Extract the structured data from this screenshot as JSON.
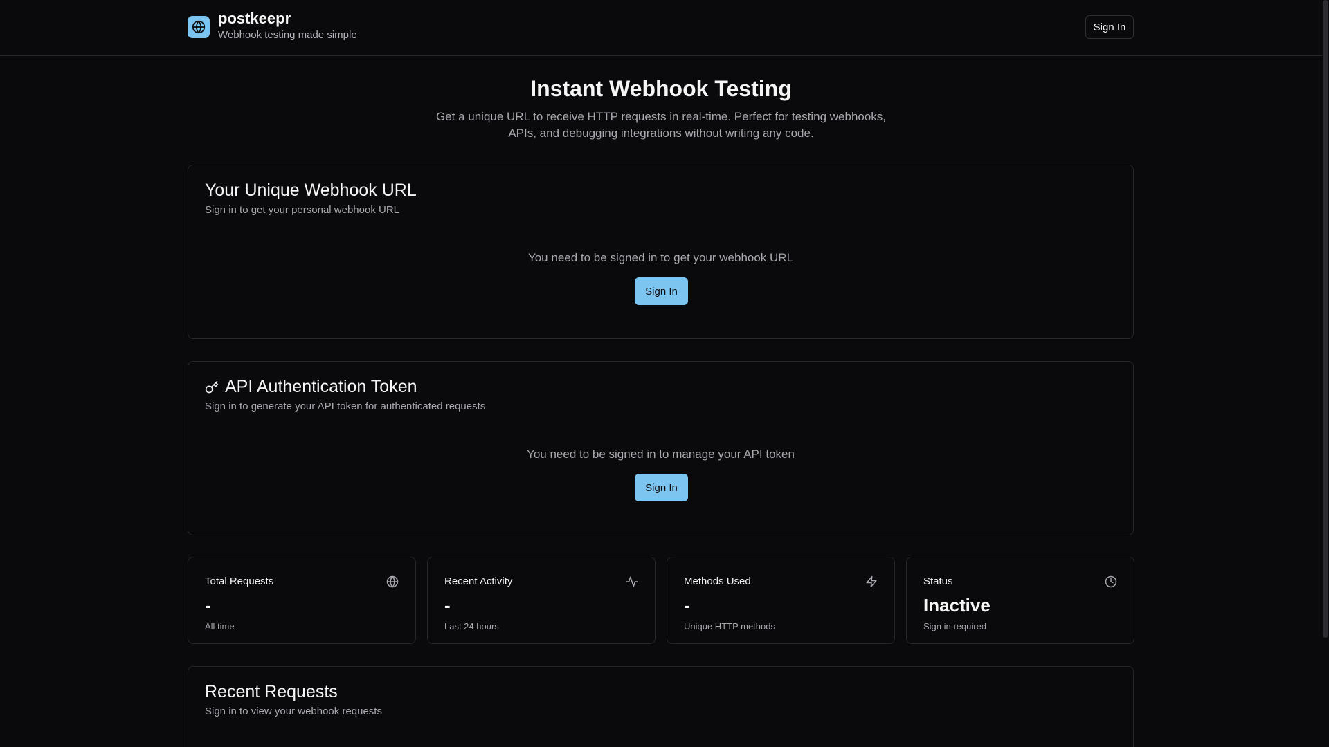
{
  "header": {
    "brand_icon": "globe-icon",
    "brand_name": "postkeepr",
    "brand_tagline": "Webhook testing made simple",
    "sign_in_label": "Sign In"
  },
  "hero": {
    "title": "Instant Webhook Testing",
    "subtitle": "Get a unique URL to receive HTTP requests in real-time. Perfect for testing webhooks, APIs, and debugging integrations without writing any code."
  },
  "webhook_card": {
    "title": "Your Unique Webhook URL",
    "subtitle": "Sign in to get your personal webhook URL",
    "message": "You need to be signed in to get your webhook URL",
    "button_label": "Sign In"
  },
  "token_card": {
    "icon": "key-icon",
    "title": "API Authentication Token",
    "subtitle": "Sign in to generate your API token for authenticated requests",
    "message": "You need to be signed in to manage your API token",
    "button_label": "Sign In"
  },
  "stats": [
    {
      "label": "Total Requests",
      "icon": "globe-icon",
      "value": "-",
      "note": "All time"
    },
    {
      "label": "Recent Activity",
      "icon": "activity-icon",
      "value": "-",
      "note": "Last 24 hours"
    },
    {
      "label": "Methods Used",
      "icon": "zap-icon",
      "value": "-",
      "note": "Unique HTTP methods"
    },
    {
      "label": "Status",
      "icon": "clock-icon",
      "value": "Inactive",
      "note": "Sign in required"
    }
  ],
  "recent_requests": {
    "title": "Recent Requests",
    "subtitle": "Sign in to view your webhook requests"
  },
  "colors": {
    "background": "#0a0a0c",
    "accent": "#7cc5f0",
    "border": "#26262b",
    "muted_text": "#a8a8ae"
  }
}
